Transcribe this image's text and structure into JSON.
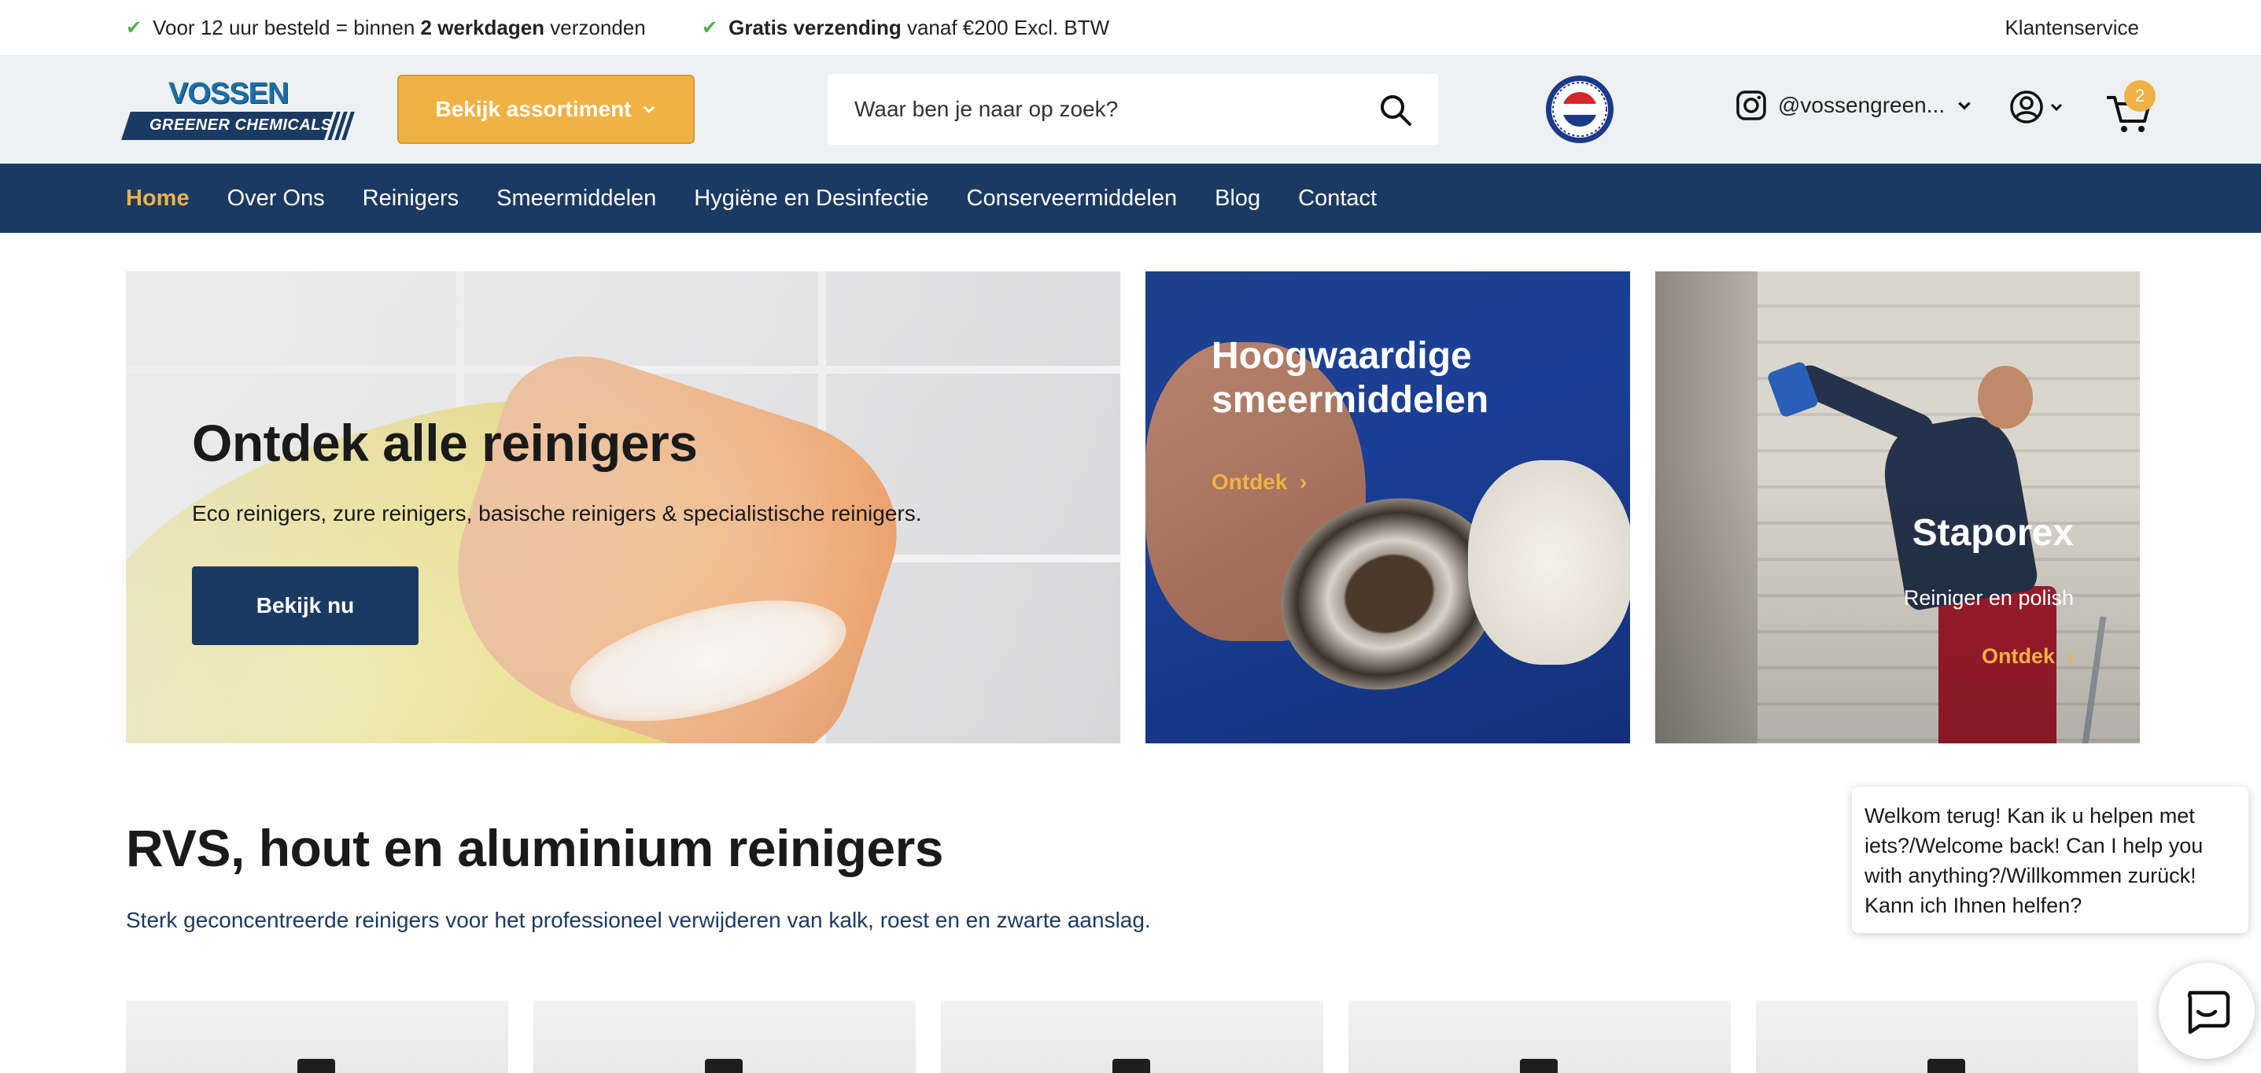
{
  "topbar": {
    "usp1": {
      "pre": "Voor 12 uur besteld = binnen ",
      "bold": "2 werkdagen",
      "post": " verzonden"
    },
    "usp2": {
      "bold": "Gratis verzending",
      "post": " vanaf €200 Excl. BTW"
    },
    "customer_service": "Klantenservice"
  },
  "header": {
    "logo_top": "VOSSEN",
    "logo_bottom": "GREENER CHEMICALS",
    "assortment_button": "Bekijk assortiment",
    "search_placeholder": "Waar ben je naar op zoek?",
    "instagram_handle": "@vossengreen...",
    "cart_count": "2"
  },
  "nav": {
    "items": [
      "Home",
      "Over Ons",
      "Reinigers",
      "Smeermiddelen",
      "Hygiëne en Desinfectie",
      "Conserveermiddelen",
      "Blog",
      "Contact"
    ]
  },
  "hero": {
    "main": {
      "title": "Ontdek alle reinigers",
      "subtitle": "Eco reinigers, zure reinigers, basische reinigers & specialistische reinigers.",
      "button": "Bekijk nu"
    },
    "lubricants": {
      "title": "Hoogwaardige smeermiddelen",
      "link": "Ontdek"
    },
    "staporex": {
      "title": "Staporex",
      "subtitle": "Reiniger en polish",
      "link": "Ontdek"
    }
  },
  "section": {
    "title": "RVS, hout en aluminium reinigers",
    "subtitle": "Sterk geconcentreerde reinigers voor het professioneel verwijderen van kalk, roest en en zwarte aanslag."
  },
  "chat": {
    "message": "Welkom terug! Kan ik u helpen met iets?/Welcome back! Can I help you with anything?/Willkommen zurück! Kann ich Ihnen helfen?"
  },
  "colors": {
    "navy": "#1b3a63",
    "accent": "#f0b244",
    "check": "#4caf50",
    "header_bg": "#eef1f1"
  },
  "icons": [
    "check-icon",
    "chevron-down-icon",
    "search-icon",
    "made-in-holland-badge",
    "instagram-icon",
    "user-icon",
    "cart-icon",
    "chevron-right-icon",
    "chat-icon"
  ]
}
